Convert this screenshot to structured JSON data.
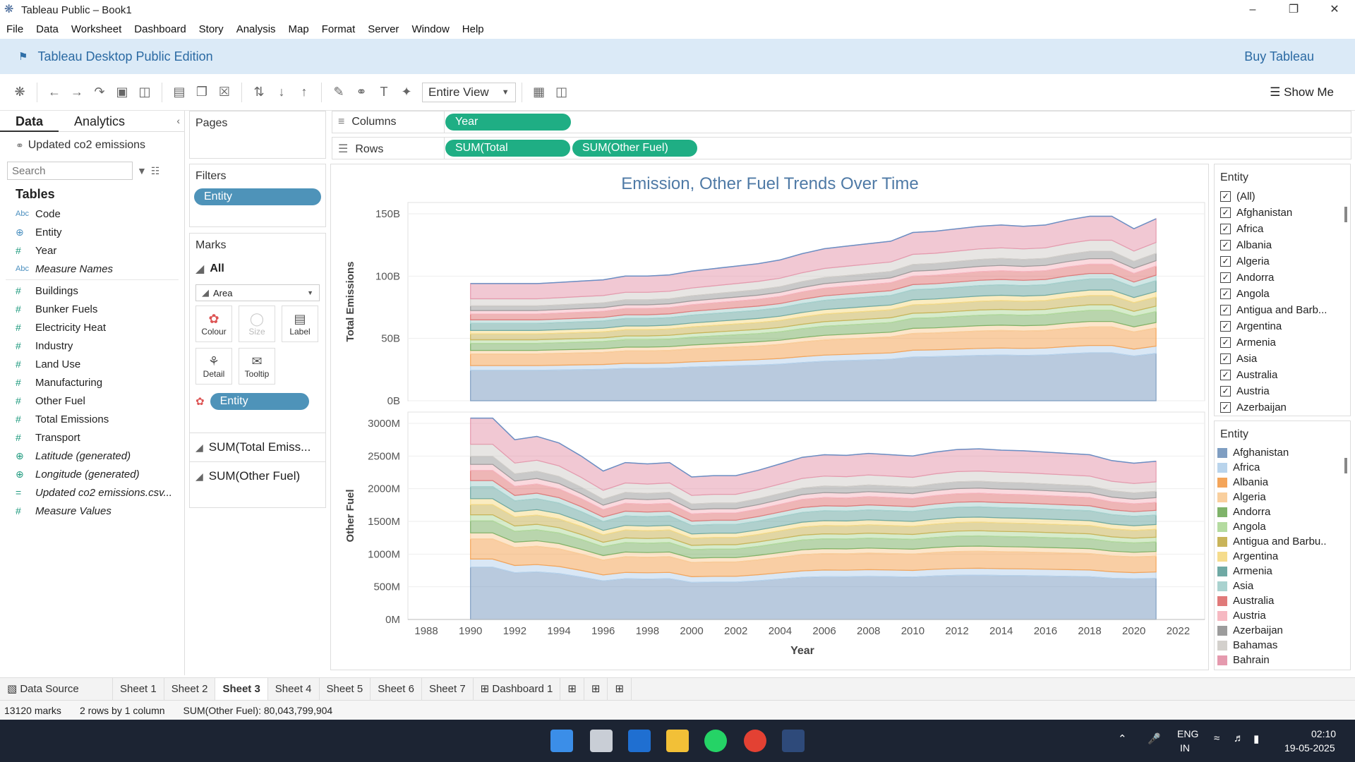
{
  "window": {
    "title": "Tableau Public – Book1"
  },
  "menu": [
    "File",
    "Data",
    "Worksheet",
    "Dashboard",
    "Story",
    "Analysis",
    "Map",
    "Format",
    "Server",
    "Window",
    "Help"
  ],
  "banner": {
    "title": "Tableau Desktop Public Edition",
    "buy": "Buy Tableau"
  },
  "toolbar": {
    "fit": "Entire View",
    "showme": "Show Me"
  },
  "datapane": {
    "tab_data": "Data",
    "tab_analytics": "Analytics",
    "source": "Updated co2 emissions",
    "search_placeholder": "Search",
    "tables_label": "Tables",
    "dims": [
      {
        "type": "Abc",
        "name": "Code"
      },
      {
        "type": "⊕",
        "name": "Entity"
      },
      {
        "type": "#",
        "name": "Year"
      },
      {
        "type": "Abc",
        "name": "Measure Names"
      }
    ],
    "measures": [
      {
        "type": "#",
        "name": "Buildings"
      },
      {
        "type": "#",
        "name": "Bunker Fuels"
      },
      {
        "type": "#",
        "name": "Electricity Heat"
      },
      {
        "type": "#",
        "name": "Industry"
      },
      {
        "type": "#",
        "name": "Land Use"
      },
      {
        "type": "#",
        "name": "Manufacturing"
      },
      {
        "type": "#",
        "name": "Other Fuel"
      },
      {
        "type": "#",
        "name": "Total Emissions"
      },
      {
        "type": "#",
        "name": "Transport"
      },
      {
        "type": "⊕",
        "name": "Latitude (generated)"
      },
      {
        "type": "⊕",
        "name": "Longitude (generated)"
      },
      {
        "type": "=",
        "name": "Updated co2 emissions.csv..."
      },
      {
        "type": "#",
        "name": "Measure Values"
      }
    ]
  },
  "pages": {
    "title": "Pages"
  },
  "filters": {
    "title": "Filters",
    "pill": "Entity"
  },
  "marks": {
    "title": "Marks",
    "all": "All",
    "type": "Area",
    "btn_colour": "Colour",
    "btn_size": "Size",
    "btn_label": "Label",
    "btn_detail": "Detail",
    "btn_tooltip": "Tooltip",
    "colour_pill": "Entity",
    "sub1": "SUM(Total Emiss...",
    "sub2": "SUM(Other Fuel)"
  },
  "shelves": {
    "columns_label": "Columns",
    "rows_label": "Rows",
    "col_pill": "Year",
    "row_pill1": "SUM(Total Emission..",
    "row_pill2": "SUM(Other Fuel)"
  },
  "filter_legend": {
    "title": "Entity",
    "items": [
      "(All)",
      "Afghanistan",
      "Africa",
      "Albania",
      "Algeria",
      "Andorra",
      "Angola",
      "Antigua and Barb...",
      "Argentina",
      "Armenia",
      "Asia",
      "Australia",
      "Austria",
      "Azerbaijan"
    ]
  },
  "colour_legend": {
    "title": "Entity",
    "items": [
      {
        "name": "Afghanistan",
        "color": "#7f9ec2"
      },
      {
        "name": "Africa",
        "color": "#b9d4ec"
      },
      {
        "name": "Albania",
        "color": "#f4a55a"
      },
      {
        "name": "Algeria",
        "color": "#f9cf9e"
      },
      {
        "name": "Andorra",
        "color": "#7fb36a"
      },
      {
        "name": "Angola",
        "color": "#b4dba0"
      },
      {
        "name": "Antigua and Barbu..",
        "color": "#c9b45a"
      },
      {
        "name": "Argentina",
        "color": "#f5dc8c"
      },
      {
        "name": "Armenia",
        "color": "#6fa9a4"
      },
      {
        "name": "Asia",
        "color": "#a9d2cf"
      },
      {
        "name": "Australia",
        "color": "#e07a7a"
      },
      {
        "name": "Austria",
        "color": "#f6b9c2"
      },
      {
        "name": "Azerbaijan",
        "color": "#9c9c9c"
      },
      {
        "name": "Bahamas",
        "color": "#d3d0cc"
      },
      {
        "name": "Bahrain",
        "color": "#e59aae"
      }
    ]
  },
  "sheets": [
    "Data Source",
    "Sheet 1",
    "Sheet 2",
    "Sheet 3",
    "Sheet 4",
    "Sheet 5",
    "Sheet 6",
    "Sheet 7",
    "Dashboard 1"
  ],
  "active_sheet": "Sheet 3",
  "status": {
    "marks": "13120 marks",
    "layout": "2 rows  by  1 column",
    "sum": "SUM(Other Fuel): 80,043,799,904"
  },
  "taskbar": {
    "lang1": "ENG",
    "lang2": "IN",
    "time": "02:10",
    "date": "19-05-2025"
  },
  "chart_data": {
    "type": "area",
    "title": "Emission, Other Fuel Trends Over Time",
    "xlabel": "Year",
    "x_ticks": [
      1988,
      1990,
      1992,
      1994,
      1996,
      1998,
      2000,
      2002,
      2004,
      2006,
      2008,
      2010,
      2012,
      2014,
      2016,
      2018,
      2020,
      2022
    ],
    "x": [
      1990,
      1991,
      1992,
      1993,
      1994,
      1995,
      1996,
      1997,
      1998,
      1999,
      2000,
      2001,
      2002,
      2003,
      2004,
      2005,
      2006,
      2007,
      2008,
      2009,
      2010,
      2011,
      2012,
      2013,
      2014,
      2015,
      2016,
      2017,
      2018,
      2019,
      2020,
      2021
    ],
    "panels": [
      {
        "ylabel": "Total Emissions",
        "y_ticks": [
          "0B",
          "50B",
          "100B",
          "150B"
        ],
        "ylim": [
          0,
          150
        ],
        "unit": "B",
        "total": [
          94,
          94,
          94,
          94,
          95,
          96,
          97,
          100,
          100,
          101,
          104,
          106,
          108,
          110,
          113,
          118,
          122,
          124,
          126,
          128,
          135,
          136,
          138,
          140,
          141,
          140,
          141,
          145,
          148,
          148,
          138,
          146
        ]
      },
      {
        "ylabel": "Other Fuel",
        "y_ticks": [
          "0M",
          "500M",
          "1000M",
          "1500M",
          "2000M",
          "2500M",
          "3000M"
        ],
        "ylim": [
          0,
          3000
        ],
        "unit": "M",
        "total": [
          3080,
          3080,
          2750,
          2800,
          2700,
          2500,
          2270,
          2400,
          2380,
          2400,
          2180,
          2200,
          2200,
          2280,
          2380,
          2480,
          2520,
          2510,
          2540,
          2520,
          2500,
          2560,
          2600,
          2610,
          2590,
          2580,
          2560,
          2540,
          2520,
          2430,
          2390,
          2420
        ]
      }
    ],
    "legend": "right"
  }
}
